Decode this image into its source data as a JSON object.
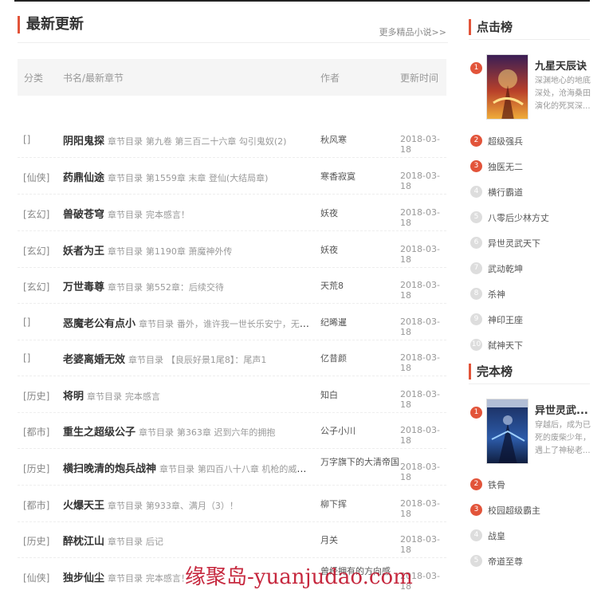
{
  "latest": {
    "title": "最新更新",
    "more": "更多精品小说>>",
    "columns": [
      "分类",
      "书名/最新章节",
      "作者",
      "更新时间"
    ],
    "chapter_prefix": "章节目录",
    "rows": [
      {
        "category": "[]",
        "book": "阴阳鬼探",
        "chapter": "第九卷 第三百二十六章 勾引鬼奴(2)",
        "author": "秋风寒",
        "time": "2018-03-18"
      },
      {
        "category": "[仙侠]",
        "book": "药鼎仙途",
        "chapter": "第1559章 末章 登仙(大结局章)",
        "author": "寒香寂寞",
        "time": "2018-03-18"
      },
      {
        "category": "[玄幻]",
        "book": "兽破苍穹",
        "chapter": "完本感言！",
        "author": "妖夜",
        "time": "2018-03-18"
      },
      {
        "category": "[玄幻]",
        "book": "妖者为王",
        "chapter": "第1190章 萧魔神外传",
        "author": "妖夜",
        "time": "2018-03-18"
      },
      {
        "category": "[玄幻]",
        "book": "万世毒尊",
        "chapter": "第552章：后续交待",
        "author": "天荒8",
        "time": "2018-03-18"
      },
      {
        "category": "[]",
        "book": "恶魔老公有点小",
        "chapter": "番外，谁许我一世长乐安宁，无忧无...",
        "author": "纪晞暹",
        "time": "2018-03-18"
      },
      {
        "category": "[]",
        "book": "老婆离婚无效",
        "chapter": "【良辰好景1尾8】：尾声1",
        "author": "亿昔颜",
        "time": "2018-03-18"
      },
      {
        "category": "[历史]",
        "book": "将明",
        "chapter": "完本感言",
        "author": "知白",
        "time": "2018-03-18"
      },
      {
        "category": "[都市]",
        "book": "重生之超级公子",
        "chapter": "第363章 迟到六年的拥抱",
        "author": "公子小川",
        "time": "2018-03-18"
      },
      {
        "category": "[历史]",
        "book": "横扫晚清的炮兵战神",
        "chapter": "第四百八十八章 机枪的威力(大...",
        "author": "万字旗下的大清帝国",
        "time": "2018-03-18"
      },
      {
        "category": "[都市]",
        "book": "火爆天王",
        "chapter": "第933章、满月（3）！",
        "author": "柳下挥",
        "time": "2018-03-18"
      },
      {
        "category": "[历史]",
        "book": "醉枕江山",
        "chapter": "后记",
        "author": "月关",
        "time": "2018-03-18"
      },
      {
        "category": "[仙侠]",
        "book": "独步仙尘",
        "chapter": "完本感言！",
        "author": "曾经拥有的方向感",
        "time": "2018-03-18"
      }
    ]
  },
  "click_rank": {
    "title": "点击榜",
    "featured": {
      "rank": "1",
      "name": "九星天辰诀",
      "desc": "深渊地心的地底深处，沧海桑田演化的死冥深..."
    },
    "items": [
      {
        "rank": "2",
        "name": "超级强兵"
      },
      {
        "rank": "3",
        "name": "独医无二"
      },
      {
        "rank": "4",
        "name": "横行霸道"
      },
      {
        "rank": "5",
        "name": "八零后少林方丈"
      },
      {
        "rank": "6",
        "name": "异世灵武天下"
      },
      {
        "rank": "7",
        "name": "武动乾坤"
      },
      {
        "rank": "8",
        "name": "杀神"
      },
      {
        "rank": "9",
        "name": "神印王座"
      },
      {
        "rank": "10",
        "name": "弑神天下"
      }
    ]
  },
  "complete_rank": {
    "title": "完本榜",
    "featured": {
      "rank": "1",
      "name": "异世灵武...",
      "desc": "穿越后，成为已死的废柴少年，遇上了神秘老..."
    },
    "items": [
      {
        "rank": "2",
        "name": "铁骨"
      },
      {
        "rank": "3",
        "name": "校园超级霸主"
      },
      {
        "rank": "4",
        "name": "战皇"
      },
      {
        "rank": "5",
        "name": "帝道至尊"
      }
    ]
  },
  "watermark": "缘聚岛-yuanjudao.com",
  "colors": {
    "accent": "#e2543a",
    "watermark": "#c0112a"
  }
}
